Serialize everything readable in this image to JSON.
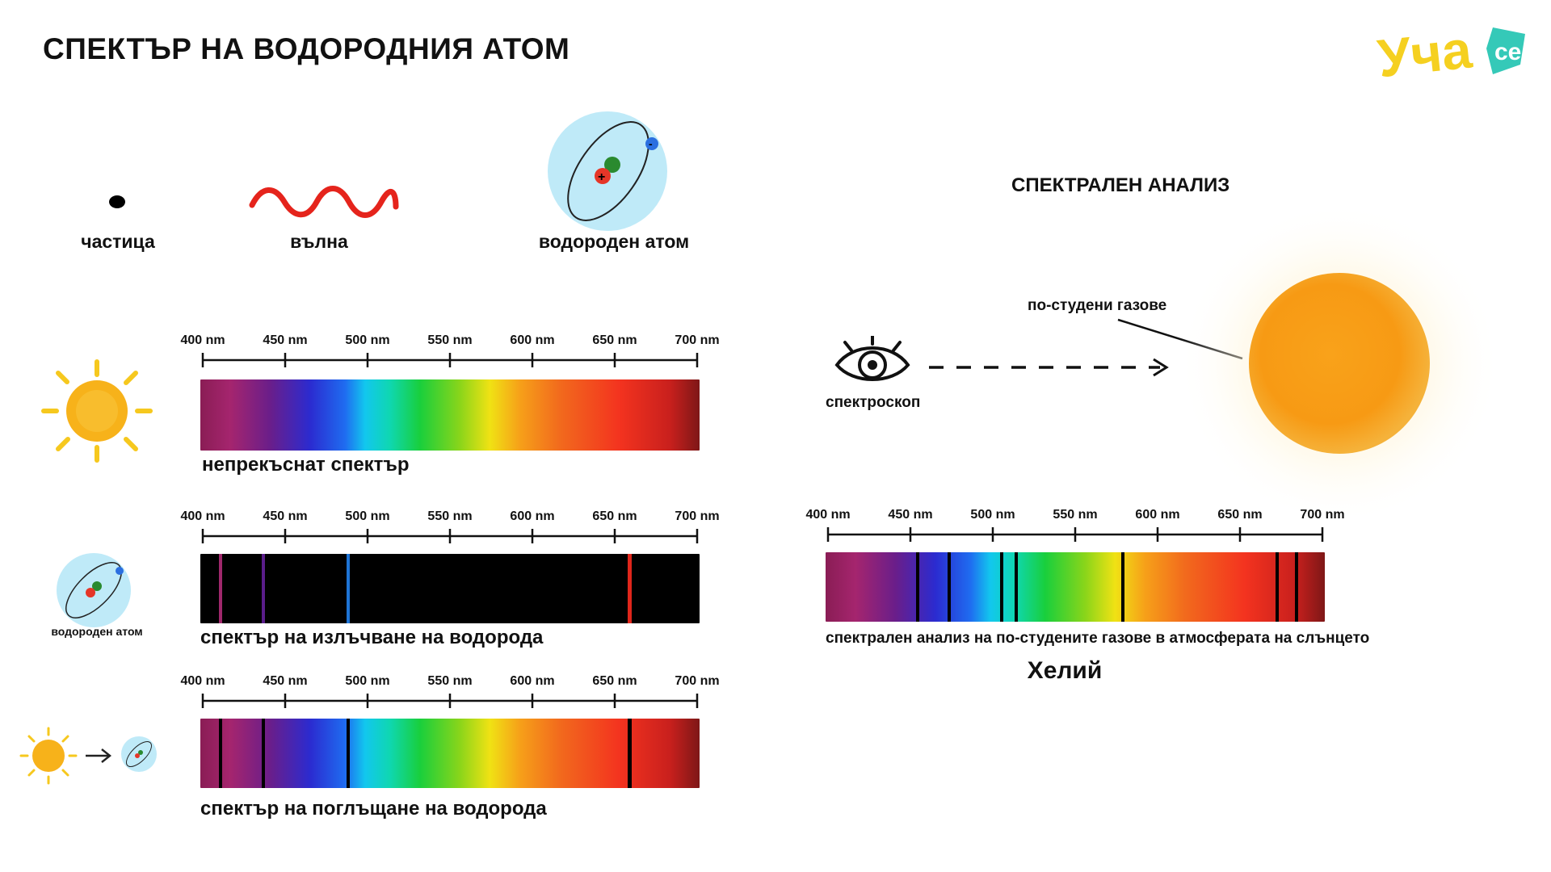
{
  "page": {
    "title": "СПЕКТЪР НА ВОДОРОДНИЯ АТОМ",
    "logo_text": "Уча",
    "logo_badge": "се"
  },
  "icons": {
    "particle": "частица",
    "wave": "вълна",
    "atom": "водороден атом",
    "atom_small": "водороден атом",
    "atom_plus": "+",
    "atom_minus": "-"
  },
  "ticks": [
    "400 nm",
    "450 nm",
    "500 nm",
    "550 nm",
    "600 nm",
    "650 nm",
    "700 nm"
  ],
  "spectra": {
    "continuous": {
      "label": "непрекъснат спектър"
    },
    "emission": {
      "label": "спектър на излъчване на водорода"
    },
    "absorption": {
      "label": "спектър на поглъщане на водорода"
    }
  },
  "analysis": {
    "heading": "СПЕКТРАЛЕН АНАЛИЗ",
    "spectroscope": "спектроскоп",
    "cool_gases": "по-студени газове",
    "caption": "спектрален анализ на по-студените газове в атмосферата на слънцето",
    "element": "Хелий"
  },
  "colors": {
    "line_purple": "#a0286c",
    "line_violet": "#5a1d8a",
    "line_blue": "#1e74d6",
    "line_red": "#e0261b",
    "atom_fill": "#bfeaf8",
    "sun": "#f7a415",
    "logo_yellow": "#f5d020",
    "logo_teal": "#35c9b8"
  }
}
